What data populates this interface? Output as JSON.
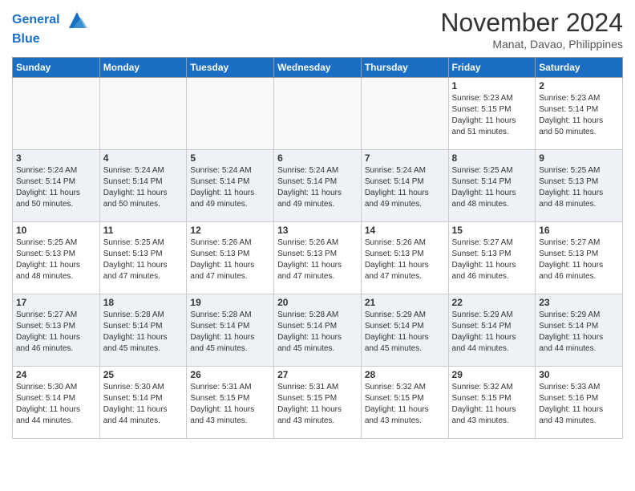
{
  "header": {
    "logo_line1": "General",
    "logo_line2": "Blue",
    "month": "November 2024",
    "location": "Manat, Davao, Philippines"
  },
  "days_of_week": [
    "Sunday",
    "Monday",
    "Tuesday",
    "Wednesday",
    "Thursday",
    "Friday",
    "Saturday"
  ],
  "weeks": [
    [
      {
        "day": "",
        "info": ""
      },
      {
        "day": "",
        "info": ""
      },
      {
        "day": "",
        "info": ""
      },
      {
        "day": "",
        "info": ""
      },
      {
        "day": "",
        "info": ""
      },
      {
        "day": "1",
        "info": "Sunrise: 5:23 AM\nSunset: 5:15 PM\nDaylight: 11 hours\nand 51 minutes."
      },
      {
        "day": "2",
        "info": "Sunrise: 5:23 AM\nSunset: 5:14 PM\nDaylight: 11 hours\nand 50 minutes."
      }
    ],
    [
      {
        "day": "3",
        "info": "Sunrise: 5:24 AM\nSunset: 5:14 PM\nDaylight: 11 hours\nand 50 minutes."
      },
      {
        "day": "4",
        "info": "Sunrise: 5:24 AM\nSunset: 5:14 PM\nDaylight: 11 hours\nand 50 minutes."
      },
      {
        "day": "5",
        "info": "Sunrise: 5:24 AM\nSunset: 5:14 PM\nDaylight: 11 hours\nand 49 minutes."
      },
      {
        "day": "6",
        "info": "Sunrise: 5:24 AM\nSunset: 5:14 PM\nDaylight: 11 hours\nand 49 minutes."
      },
      {
        "day": "7",
        "info": "Sunrise: 5:24 AM\nSunset: 5:14 PM\nDaylight: 11 hours\nand 49 minutes."
      },
      {
        "day": "8",
        "info": "Sunrise: 5:25 AM\nSunset: 5:14 PM\nDaylight: 11 hours\nand 48 minutes."
      },
      {
        "day": "9",
        "info": "Sunrise: 5:25 AM\nSunset: 5:13 PM\nDaylight: 11 hours\nand 48 minutes."
      }
    ],
    [
      {
        "day": "10",
        "info": "Sunrise: 5:25 AM\nSunset: 5:13 PM\nDaylight: 11 hours\nand 48 minutes."
      },
      {
        "day": "11",
        "info": "Sunrise: 5:25 AM\nSunset: 5:13 PM\nDaylight: 11 hours\nand 47 minutes."
      },
      {
        "day": "12",
        "info": "Sunrise: 5:26 AM\nSunset: 5:13 PM\nDaylight: 11 hours\nand 47 minutes."
      },
      {
        "day": "13",
        "info": "Sunrise: 5:26 AM\nSunset: 5:13 PM\nDaylight: 11 hours\nand 47 minutes."
      },
      {
        "day": "14",
        "info": "Sunrise: 5:26 AM\nSunset: 5:13 PM\nDaylight: 11 hours\nand 47 minutes."
      },
      {
        "day": "15",
        "info": "Sunrise: 5:27 AM\nSunset: 5:13 PM\nDaylight: 11 hours\nand 46 minutes."
      },
      {
        "day": "16",
        "info": "Sunrise: 5:27 AM\nSunset: 5:13 PM\nDaylight: 11 hours\nand 46 minutes."
      }
    ],
    [
      {
        "day": "17",
        "info": "Sunrise: 5:27 AM\nSunset: 5:13 PM\nDaylight: 11 hours\nand 46 minutes."
      },
      {
        "day": "18",
        "info": "Sunrise: 5:28 AM\nSunset: 5:14 PM\nDaylight: 11 hours\nand 45 minutes."
      },
      {
        "day": "19",
        "info": "Sunrise: 5:28 AM\nSunset: 5:14 PM\nDaylight: 11 hours\nand 45 minutes."
      },
      {
        "day": "20",
        "info": "Sunrise: 5:28 AM\nSunset: 5:14 PM\nDaylight: 11 hours\nand 45 minutes."
      },
      {
        "day": "21",
        "info": "Sunrise: 5:29 AM\nSunset: 5:14 PM\nDaylight: 11 hours\nand 45 minutes."
      },
      {
        "day": "22",
        "info": "Sunrise: 5:29 AM\nSunset: 5:14 PM\nDaylight: 11 hours\nand 44 minutes."
      },
      {
        "day": "23",
        "info": "Sunrise: 5:29 AM\nSunset: 5:14 PM\nDaylight: 11 hours\nand 44 minutes."
      }
    ],
    [
      {
        "day": "24",
        "info": "Sunrise: 5:30 AM\nSunset: 5:14 PM\nDaylight: 11 hours\nand 44 minutes."
      },
      {
        "day": "25",
        "info": "Sunrise: 5:30 AM\nSunset: 5:14 PM\nDaylight: 11 hours\nand 44 minutes."
      },
      {
        "day": "26",
        "info": "Sunrise: 5:31 AM\nSunset: 5:15 PM\nDaylight: 11 hours\nand 43 minutes."
      },
      {
        "day": "27",
        "info": "Sunrise: 5:31 AM\nSunset: 5:15 PM\nDaylight: 11 hours\nand 43 minutes."
      },
      {
        "day": "28",
        "info": "Sunrise: 5:32 AM\nSunset: 5:15 PM\nDaylight: 11 hours\nand 43 minutes."
      },
      {
        "day": "29",
        "info": "Sunrise: 5:32 AM\nSunset: 5:15 PM\nDaylight: 11 hours\nand 43 minutes."
      },
      {
        "day": "30",
        "info": "Sunrise: 5:33 AM\nSunset: 5:16 PM\nDaylight: 11 hours\nand 43 minutes."
      }
    ]
  ]
}
